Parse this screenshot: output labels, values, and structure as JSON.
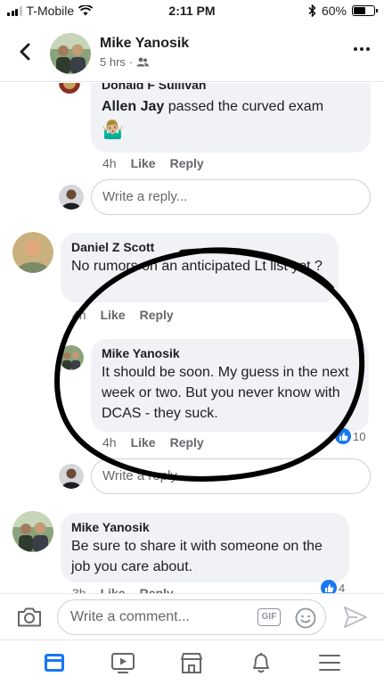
{
  "status_bar": {
    "carrier": "T-Mobile",
    "time": "2:11 PM",
    "battery": "60%",
    "battery_level": 0.6
  },
  "header": {
    "name": "Mike Yanosik",
    "timestamp": "5 hrs",
    "separator": "·",
    "audience_icon": "friends-icon"
  },
  "comments": [
    {
      "author_partial": "Donald F Sullivan",
      "text_author": "Allen Jay",
      "text": " passed the curved exam",
      "emoji": "🤷🏼‍♂️",
      "time": "4h",
      "like": "Like",
      "reply": "Reply"
    },
    {
      "author": "Daniel Z Scott",
      "text": "No rumors on an anticipated Lt list yet ?",
      "time": "4h",
      "like": "Like",
      "reply": "Reply"
    },
    {
      "author": "Mike Yanosik",
      "text": "It should be soon. My guess in the next week or two. But you never know with DCAS - they suck.",
      "time": "4h",
      "like": "Like",
      "reply": "Reply",
      "reactions": "10"
    },
    {
      "author": "Mike Yanosik",
      "text": "Be sure to share it with someone on the job you care about.",
      "time": "3h",
      "like": "Like",
      "reply": "Reply",
      "reactions": "4"
    }
  ],
  "reply_placeholder": "Write a reply...",
  "reply_placeholder_2": "Write a reply...",
  "comment_bar": {
    "placeholder": "Write a comment...",
    "gif_label": "GIF"
  },
  "tabs": [
    "news-feed-icon",
    "watch-icon",
    "marketplace-icon",
    "notifications-icon",
    "menu-icon"
  ],
  "colors": {
    "accent": "#1877f2",
    "bubble": "#f0f2f5",
    "muted": "#65676b"
  }
}
